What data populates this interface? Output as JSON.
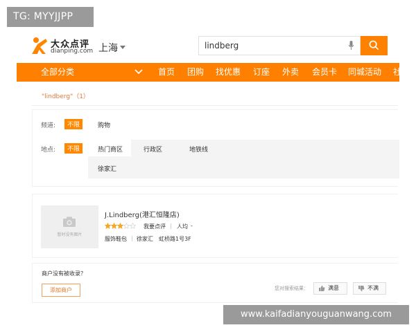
{
  "overlay": {
    "top_left_tag": "TG: MYYJJPP",
    "bottom_right_tag": "www.kaifadianyouguanwang.com"
  },
  "header": {
    "logo_cn": "大众点评",
    "logo_en": "dianping.com",
    "city": "上海",
    "search_value": "lindberg",
    "icons": {
      "mic": "microphone-icon",
      "search": "search-icon",
      "logo": "dianping-logo-icon"
    },
    "accent_color": "#ff8000"
  },
  "nav": {
    "all_categories": "全部分类",
    "items": [
      "首页",
      "团购",
      "找优惠",
      "订座",
      "外卖",
      "会员卡",
      "同城活动",
      "社"
    ]
  },
  "results": {
    "summary": "\"lindberg\"（1）"
  },
  "filters": {
    "channel_label": "频道:",
    "channel_any": "不限",
    "channel_option": "购物",
    "location_label": "地点:",
    "location_any": "不限",
    "location_tabs": [
      "热门商区",
      "行政区",
      "地铁线"
    ],
    "location_sub": "徐家汇"
  },
  "shop": {
    "name": "J.Lindberg(港汇恒隆店)",
    "rating_stars": 3,
    "rating_max": 5,
    "review_link": "我要点评",
    "avg_label": "人均",
    "avg_value": "-",
    "category": "服饰鞋包",
    "area": "徐家汇",
    "address": "虹桥路1号3F",
    "thumb_placeholder": "暂时没有图片"
  },
  "feedback": {
    "question": "商户没有被收录？",
    "add_button": "添加商户",
    "ask": "您对搜索结果：",
    "satisfied": "满意",
    "unsatisfied": "不满"
  }
}
